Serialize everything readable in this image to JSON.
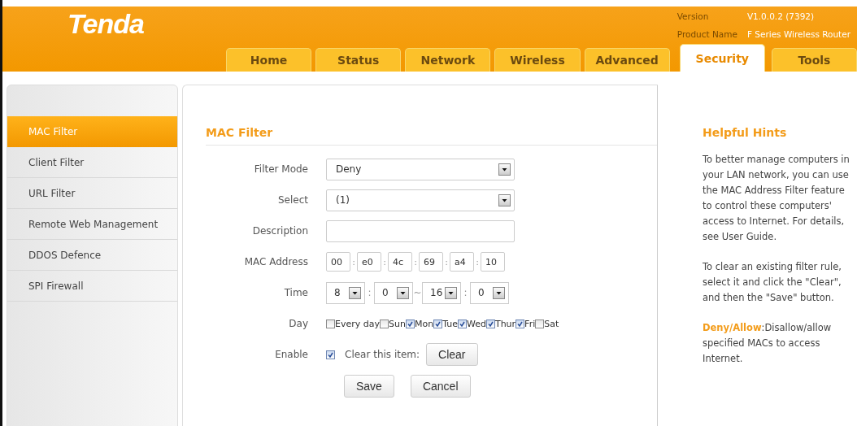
{
  "header": {
    "logo": "Tenda",
    "version_label": "Version",
    "version": "V1.0.0.2 (7392)",
    "product_label": "Product Name",
    "product": "F Series Wireless Router"
  },
  "tabs": [
    {
      "label": "Home",
      "selected": false
    },
    {
      "label": "Status",
      "selected": false
    },
    {
      "label": "Network",
      "selected": false
    },
    {
      "label": "Wireless",
      "selected": false
    },
    {
      "label": "Advanced",
      "selected": false
    },
    {
      "label": "Security",
      "selected": true
    },
    {
      "label": "Tools",
      "selected": false
    }
  ],
  "sidebar": {
    "items": [
      {
        "label": "MAC Filter",
        "selected": true
      },
      {
        "label": "Client Filter",
        "selected": false
      },
      {
        "label": "URL Filter",
        "selected": false
      },
      {
        "label": "Remote Web Management",
        "selected": false
      },
      {
        "label": "DDOS Defence",
        "selected": false
      },
      {
        "label": "SPI Firewall",
        "selected": false
      }
    ]
  },
  "form": {
    "title": "MAC Filter",
    "filter_mode": {
      "label": "Filter Mode",
      "value": "Deny"
    },
    "select": {
      "label": "Select",
      "value": "(1)"
    },
    "description": {
      "label": "Description"
    },
    "mac_address": {
      "label": "MAC Address",
      "separator": ":",
      "octets": [
        "00",
        "e0",
        "4c",
        "69",
        "a4",
        "10"
      ]
    },
    "time": {
      "label": "Time",
      "colon": ":",
      "range_sep": "~",
      "start_hour": "8",
      "start_minute": "0",
      "end_hour": "16",
      "end_minute": "0"
    },
    "day": {
      "label": "Day",
      "options": [
        {
          "label": "Every day",
          "checked": false
        },
        {
          "label": "Sun",
          "checked": false
        },
        {
          "label": "Mon",
          "checked": true
        },
        {
          "label": "Tue",
          "checked": true
        },
        {
          "label": "Wed",
          "checked": true
        },
        {
          "label": "Thur",
          "checked": true
        },
        {
          "label": "Fri",
          "checked": true
        },
        {
          "label": "Sat",
          "checked": false
        }
      ]
    },
    "enable": {
      "label": "Enable",
      "checked": true,
      "clear_label": "Clear this item:",
      "clear_button": "Clear"
    },
    "buttons": [
      "Save",
      "Cancel"
    ]
  },
  "hints": {
    "title": "Helpful Hints",
    "paragraphs": [
      "To better manage computers in your LAN network, you can use the MAC Address Filter feature to control these computers' access to Internet. For details, see User Guide.",
      "To clear an existing filter rule, select it and click the \"Clear\", and then the \"Save\" button.",
      "**Deny/Allow**:Disallow/allow specified MACs to access Internet."
    ]
  }
}
